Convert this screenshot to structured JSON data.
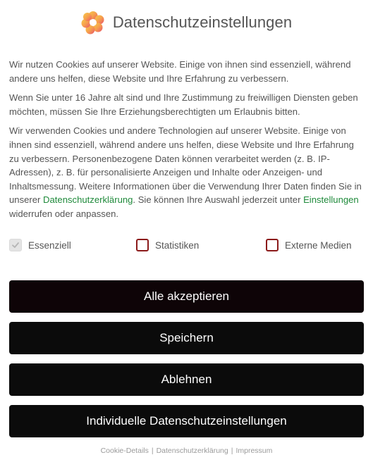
{
  "header": {
    "title": "Datenschutzeinstellungen",
    "logo_icon": "flower-logo-icon",
    "logo_colors": [
      "#f6a04d",
      "#e8516b",
      "#f7c94a"
    ]
  },
  "content": {
    "p1": "Wir nutzen Cookies auf unserer Website. Einige von ihnen sind essenziell, während andere uns helfen, diese Website und Ihre Erfahrung zu verbessern.",
    "p2": "Wenn Sie unter 16 Jahre alt sind und Ihre Zustimmung zu freiwilligen Diensten geben möchten, müssen Sie Ihre Erziehungsberechtigten um Erlaubnis bitten.",
    "p3_a": "Wir verwenden Cookies und andere Technologien auf unserer Website. Einige von ihnen sind essenziell, während andere uns helfen, diese Website und Ihre Erfahrung zu verbessern. Personenbezogene Daten können verarbeitet werden (z. B. IP-Adressen), z. B. für personalisierte Anzeigen und Inhalte oder Anzeigen- und Inhaltsmessung. Weitere Informationen über die Verwendung Ihrer Daten finden Sie in unserer ",
    "p3_link1": "Datenschutzerklärung",
    "p3_b": ". Sie können Ihre Auswahl jederzeit unter ",
    "p3_link2": "Einstellungen",
    "p3_c": " widerrufen oder anpassen.",
    "link_color": "#1f8a3b"
  },
  "checkboxes": [
    {
      "label": "Essenziell",
      "checked": true,
      "disabled": true
    },
    {
      "label": "Statistiken",
      "checked": false,
      "disabled": false
    },
    {
      "label": "Externe Medien",
      "checked": false,
      "disabled": false
    }
  ],
  "buttons": {
    "accept_all": "Alle akzeptieren",
    "save": "Speichern",
    "reject": "Ablehnen",
    "individual": "Individuelle Datenschutzeinstellungen",
    "accept_all_color": "#0e0407",
    "other_color": "#0b0b0b"
  },
  "footer": {
    "cookie_details": "Cookie-Details",
    "privacy": "Datenschutzerklärung",
    "imprint": "Impressum",
    "separator": "|"
  }
}
